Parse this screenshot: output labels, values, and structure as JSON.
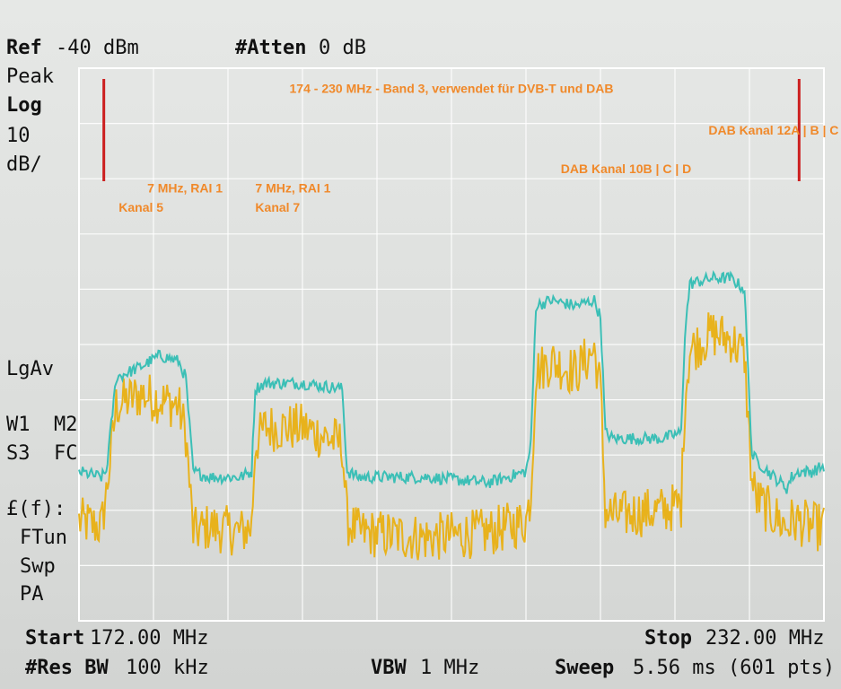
{
  "header": {
    "ref_label": "Ref",
    "ref_value": "-40 dBm",
    "atten_label": "#Atten",
    "atten_value": "0 dB"
  },
  "left_panel": {
    "detector": "Peak",
    "scale_type": "Log",
    "scale_value": "10",
    "scale_unit": "dB/",
    "avg_mode": "LgAv",
    "traces_1": "W1  M2",
    "traces_2": "S3  FC",
    "func": "£(f):",
    "ftun": "FTun",
    "swp": "Swp",
    "pa": "PA"
  },
  "footer": {
    "start_label": "Start",
    "start_value": "172.00 MHz",
    "stop_label": "Stop",
    "stop_value": "232.00 MHz",
    "rbw_label": "#Res BW",
    "rbw_value": "100 kHz",
    "vbw_label": "VBW",
    "vbw_value": "1 MHz",
    "sweep_label": "Sweep",
    "sweep_value": "5.56 ms (601 pts)"
  },
  "colors": {
    "screen_bg": "#dcdedc",
    "grid": "#ffffff",
    "peak_trace": "#3bbfb6",
    "avg_trace": "#e8b21c",
    "band_marker": "#cc1f1f",
    "annotation": "#f0892a"
  },
  "chart_data": {
    "type": "line",
    "title": "",
    "x_unit": "MHz",
    "y_unit": "dBm",
    "xlim": [
      172,
      232
    ],
    "ylim": [
      -140,
      -40
    ],
    "grid": true,
    "series": [
      {
        "name": "Peak",
        "x": [
          172,
          173.8,
          174.2,
          175,
          177,
          178.5,
          180,
          180.6,
          181.2,
          182.5,
          185,
          185.9,
          186.2,
          187,
          190,
          193.2,
          193.6,
          194.5,
          200,
          205,
          208,
          208.4,
          208.8,
          210,
          212,
          213.5,
          214,
          214.4,
          215,
          219,
          220.5,
          220.8,
          221.2,
          223,
          224.5,
          225.6,
          226.2,
          226.6,
          227.5,
          228.5,
          229,
          229.4,
          230,
          231,
          232
        ],
        "values": [
          -113,
          -114,
          -113,
          -96,
          -94,
          -92,
          -93,
          -96,
          -113,
          -114,
          -114,
          -113,
          -98,
          -97,
          -97,
          -98,
          -113,
          -114,
          -114,
          -115,
          -113,
          -108,
          -83,
          -82,
          -83,
          -82,
          -85,
          -106,
          -107,
          -107,
          -106,
          -88,
          -79,
          -78,
          -78,
          -80,
          -110,
          -111,
          -113,
          -115,
          -116,
          -114,
          -113,
          -113,
          -112
        ]
      },
      {
        "name": "Avg",
        "x": [
          172,
          173.8,
          174.2,
          175,
          177,
          178.5,
          180,
          180.6,
          181.2,
          182.5,
          185,
          185.9,
          186.2,
          187,
          190,
          193.2,
          193.6,
          194.5,
          200,
          205,
          208,
          208.4,
          208.8,
          210,
          212,
          213.5,
          214,
          214.4,
          215,
          219,
          220.5,
          220.8,
          221.2,
          223,
          224.5,
          225.6,
          226.2,
          226.6,
          227.5,
          228.5,
          229,
          229.4,
          230,
          231,
          232
        ],
        "values": [
          -122,
          -123,
          -117,
          -101,
          -99,
          -100,
          -101,
          -106,
          -124,
          -123,
          -124,
          -123,
          -108,
          -105,
          -105,
          -108,
          -122,
          -124,
          -125,
          -124,
          -122,
          -117,
          -95,
          -93,
          -95,
          -91,
          -98,
          -120,
          -121,
          -120,
          -119,
          -100,
          -91,
          -88,
          -89,
          -92,
          -115,
          -118,
          -120,
          -122,
          -123,
          -122,
          -122,
          -123,
          -123
        ]
      }
    ],
    "annotations": [
      {
        "text": "174 - 230 MHz - Band 3, verwendet für DVB-T und DAB",
        "x": 202,
        "y": -44.5
      },
      {
        "text": "DAB Kanal 12A | B | C",
        "x": 222.7,
        "y": -52
      },
      {
        "text": "DAB Kanal 10B | C | D",
        "x": 210.8,
        "y": -59
      },
      {
        "text": "7 MHz, RAI 1",
        "x": 177.5,
        "y": -62.5
      },
      {
        "text": "Kanal 5",
        "x": 175.2,
        "y": -66
      },
      {
        "text": "7 MHz, RAI 1",
        "x": 186.2,
        "y": -62.5
      },
      {
        "text": "Kanal 7",
        "x": 186.2,
        "y": -66
      }
    ],
    "band_markers_mhz": [
      174,
      230
    ]
  }
}
